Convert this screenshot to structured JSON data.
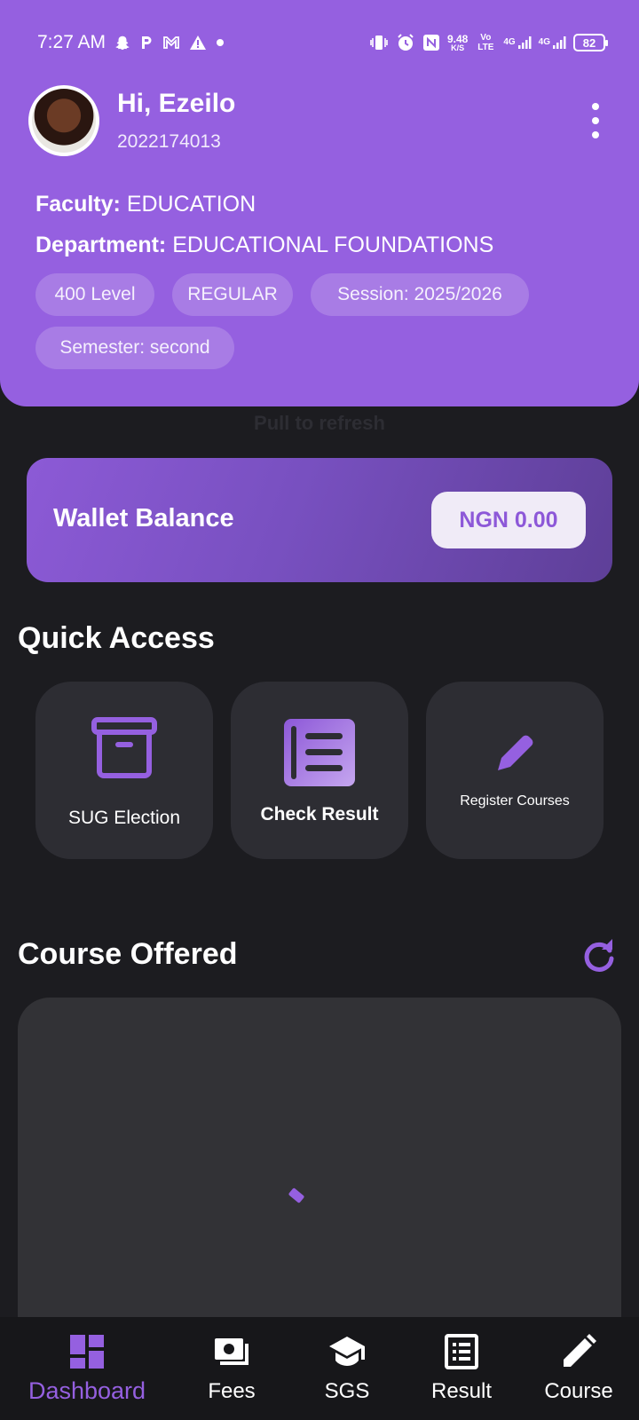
{
  "status_bar": {
    "time": "7:27 AM",
    "net_speed_value": "9.48",
    "net_speed_unit": "K/S",
    "volte": "Vo LTE",
    "network1": "4G",
    "network2": "4G",
    "battery": "82",
    "left_icons": [
      "snapchat-icon",
      "p-icon",
      "gmail-icon",
      "warning-icon",
      "dot-icon"
    ],
    "right_icons": [
      "vibrate-icon",
      "alarm-icon",
      "nfc-icon"
    ]
  },
  "profile": {
    "greeting": "Hi, Ezeilo",
    "student_id": "2022174013",
    "faculty_label": "Faculty:",
    "faculty_value": "EDUCATION",
    "department_label": "Department:",
    "department_value": "EDUCATIONAL FOUNDATIONS",
    "chips": [
      "400 Level",
      "REGULAR",
      "Session: 2025/2026",
      "Semester: second"
    ]
  },
  "pull_to_refresh": "Pull to refresh",
  "wallet": {
    "label": "Wallet Balance",
    "balance": "NGN 0.00"
  },
  "quick_access": {
    "title": "Quick Access",
    "items": [
      {
        "label": "SUG Election",
        "icon": "archive-box-icon"
      },
      {
        "label": "Check Result",
        "icon": "notebook-icon"
      },
      {
        "label": "Register Courses",
        "icon": "pencil-icon"
      }
    ]
  },
  "courses": {
    "title": "Course Offered",
    "refresh_icon": "refresh-icon"
  },
  "bottom_nav": {
    "items": [
      {
        "label": "Dashboard",
        "icon": "dashboard-icon",
        "active": true
      },
      {
        "label": "Fees",
        "icon": "money-icon",
        "active": false
      },
      {
        "label": "SGS",
        "icon": "graduation-cap-icon",
        "active": false
      },
      {
        "label": "Result",
        "icon": "list-document-icon",
        "active": false
      },
      {
        "label": "Course",
        "icon": "pencil-icon",
        "active": false
      }
    ]
  },
  "colors": {
    "accent": "#9560e0",
    "background": "#1c1c20",
    "tile": "#2d2d33",
    "nav": "#17171a"
  }
}
